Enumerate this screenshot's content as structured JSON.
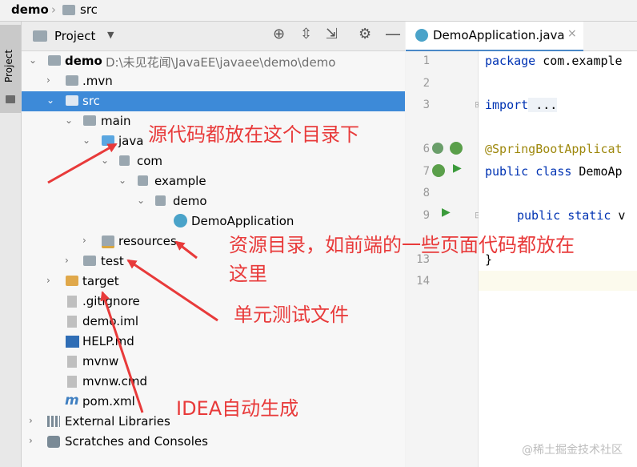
{
  "breadcrumb": {
    "project": "demo",
    "folder": "src"
  },
  "side_strip": {
    "project_tab": "Project"
  },
  "project_panel": {
    "title": "Project"
  },
  "tree": {
    "root_name": "demo",
    "root_path": "D:\\未见花闻\\JavaEE\\javaee\\demo\\demo",
    "mvn": ".mvn",
    "src": "src",
    "main": "main",
    "java": "java",
    "com": "com",
    "example": "example",
    "demo_pkg": "demo",
    "app_class": "DemoApplication",
    "resources": "resources",
    "test": "test",
    "target": "target",
    "gitignore": ".gitignore",
    "iml": "demo.iml",
    "help": "HELP.md",
    "mvnw": "mvnw",
    "mvnw_cmd": "mvnw.cmd",
    "pom": "pom.xml",
    "external_libraries": "External Libraries",
    "scratches": "Scratches and Consoles"
  },
  "editor": {
    "tab_label": "DemoApplication.java",
    "line_numbers": [
      "1",
      "2",
      "3",
      "6",
      "7",
      "8",
      "9",
      "13",
      "14"
    ],
    "code": {
      "l1_kw": "package",
      "l1_rest": " com.example",
      "l3_kw": "import",
      "l3_rest": " ...",
      "l6": "@SpringBootApplicat",
      "l7_kw": "public class",
      "l7_rest": " DemoAp",
      "l9_kw": "public static",
      "l9_rest": " v",
      "l13": "}"
    }
  },
  "annotations": {
    "java_dir": "源代码都放在这个目录下",
    "resources_line1": "资源目录，如前端的一些页面代码都放在",
    "resources_line2": "这里",
    "test_dir": "单元测试文件",
    "idea_generated": "IDEA自动生成"
  },
  "watermark": "@稀土掘金技术社区",
  "colors": {
    "selection": "#3d8ad8",
    "annotation": "#e83a3a",
    "keyword": "#0033b3",
    "annotation_code": "#9e880d"
  }
}
